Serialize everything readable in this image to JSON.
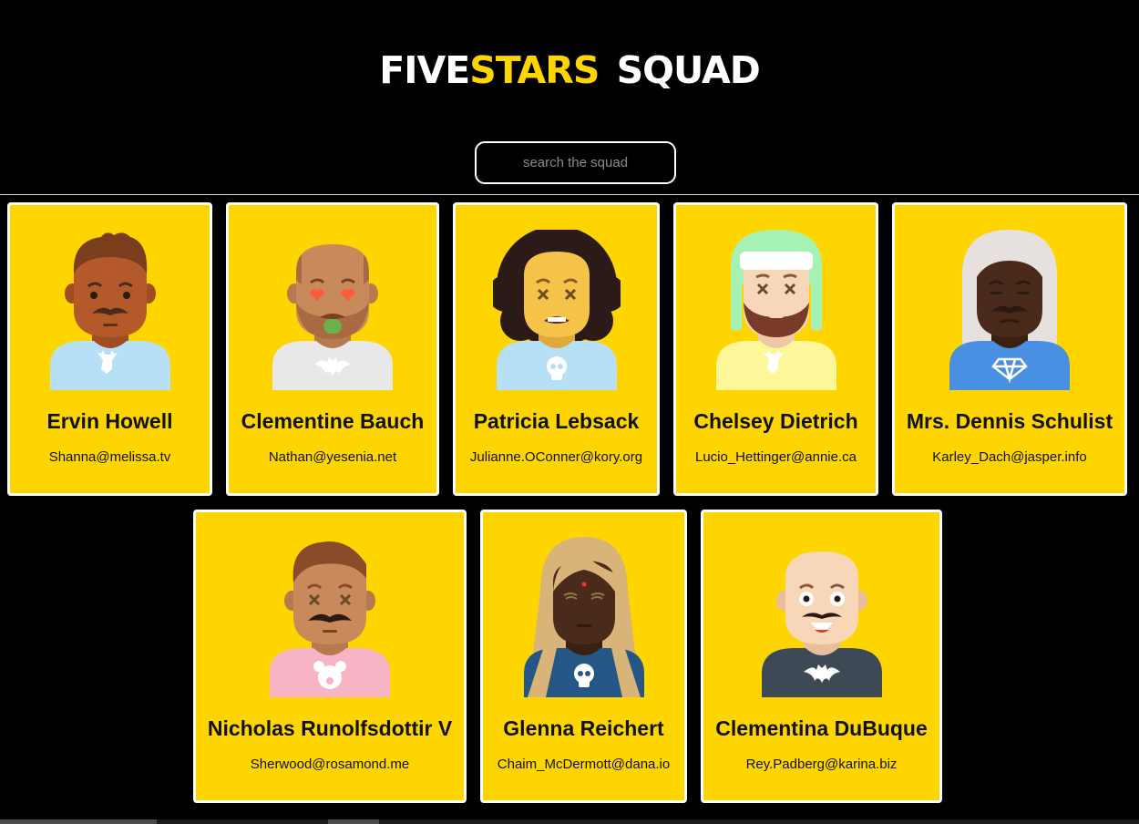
{
  "header": {
    "logo_part1": "FiveStars",
    "logo_part1_five": "Five",
    "logo_part1_stars": "Stars",
    "logo_part2": "Squad",
    "accent_color": "#ffd500"
  },
  "search": {
    "placeholder": "search the squad",
    "value": ""
  },
  "cards": [
    {
      "name": "Ervin Howell",
      "email": "Shanna@melissa.tv",
      "skin": "#b3592a",
      "hair": "#7a3e1c",
      "shirt": "#b7e0f7",
      "shirt_icon": "deer-icon"
    },
    {
      "name": "Clementine Bauch",
      "email": "Nathan@yesenia.net",
      "skin": "#c98a5b",
      "hair": "#b06a40",
      "shirt": "#e8e8e8",
      "shirt_icon": "bat-icon"
    },
    {
      "name": "Patricia Lebsack",
      "email": "Julianne.OConner@kory.org",
      "skin": "#f5c34a",
      "hair": "#2b1a18",
      "shirt": "#b7e0f7",
      "shirt_icon": "skull-icon"
    },
    {
      "name": "Chelsey Dietrich",
      "email": "Lucio_Hettinger@annie.ca",
      "skin": "#f8d6b8",
      "hair": "#a6f2b5",
      "shirt": "#fdf79a",
      "shirt_icon": "deer-icon"
    },
    {
      "name": "Mrs. Dennis Schulist",
      "email": "Karley_Dach@jasper.info",
      "skin": "#4a2a1a",
      "hair": "#e6e0df",
      "shirt": "#4a90e2",
      "shirt_icon": "diamond-icon"
    },
    {
      "name": "Nicholas Runolfsdottir V",
      "email": "Sherwood@rosamond.me",
      "skin": "#c98a5b",
      "hair": "#8a4b2a",
      "shirt": "#f7b4c4",
      "shirt_icon": "bear-icon"
    },
    {
      "name": "Glenna Reichert",
      "email": "Chaim_McDermott@dana.io",
      "skin": "#4a2a1a",
      "hair": "#d9b478",
      "shirt": "#245785",
      "shirt_icon": "skull-icon"
    },
    {
      "name": "Clementina DuBuque",
      "email": "Rey.Padberg@karina.biz",
      "skin": "#f8d6b8",
      "hair": "#f8d6b8",
      "shirt": "#3d4a55",
      "shirt_icon": "bat-icon"
    }
  ]
}
